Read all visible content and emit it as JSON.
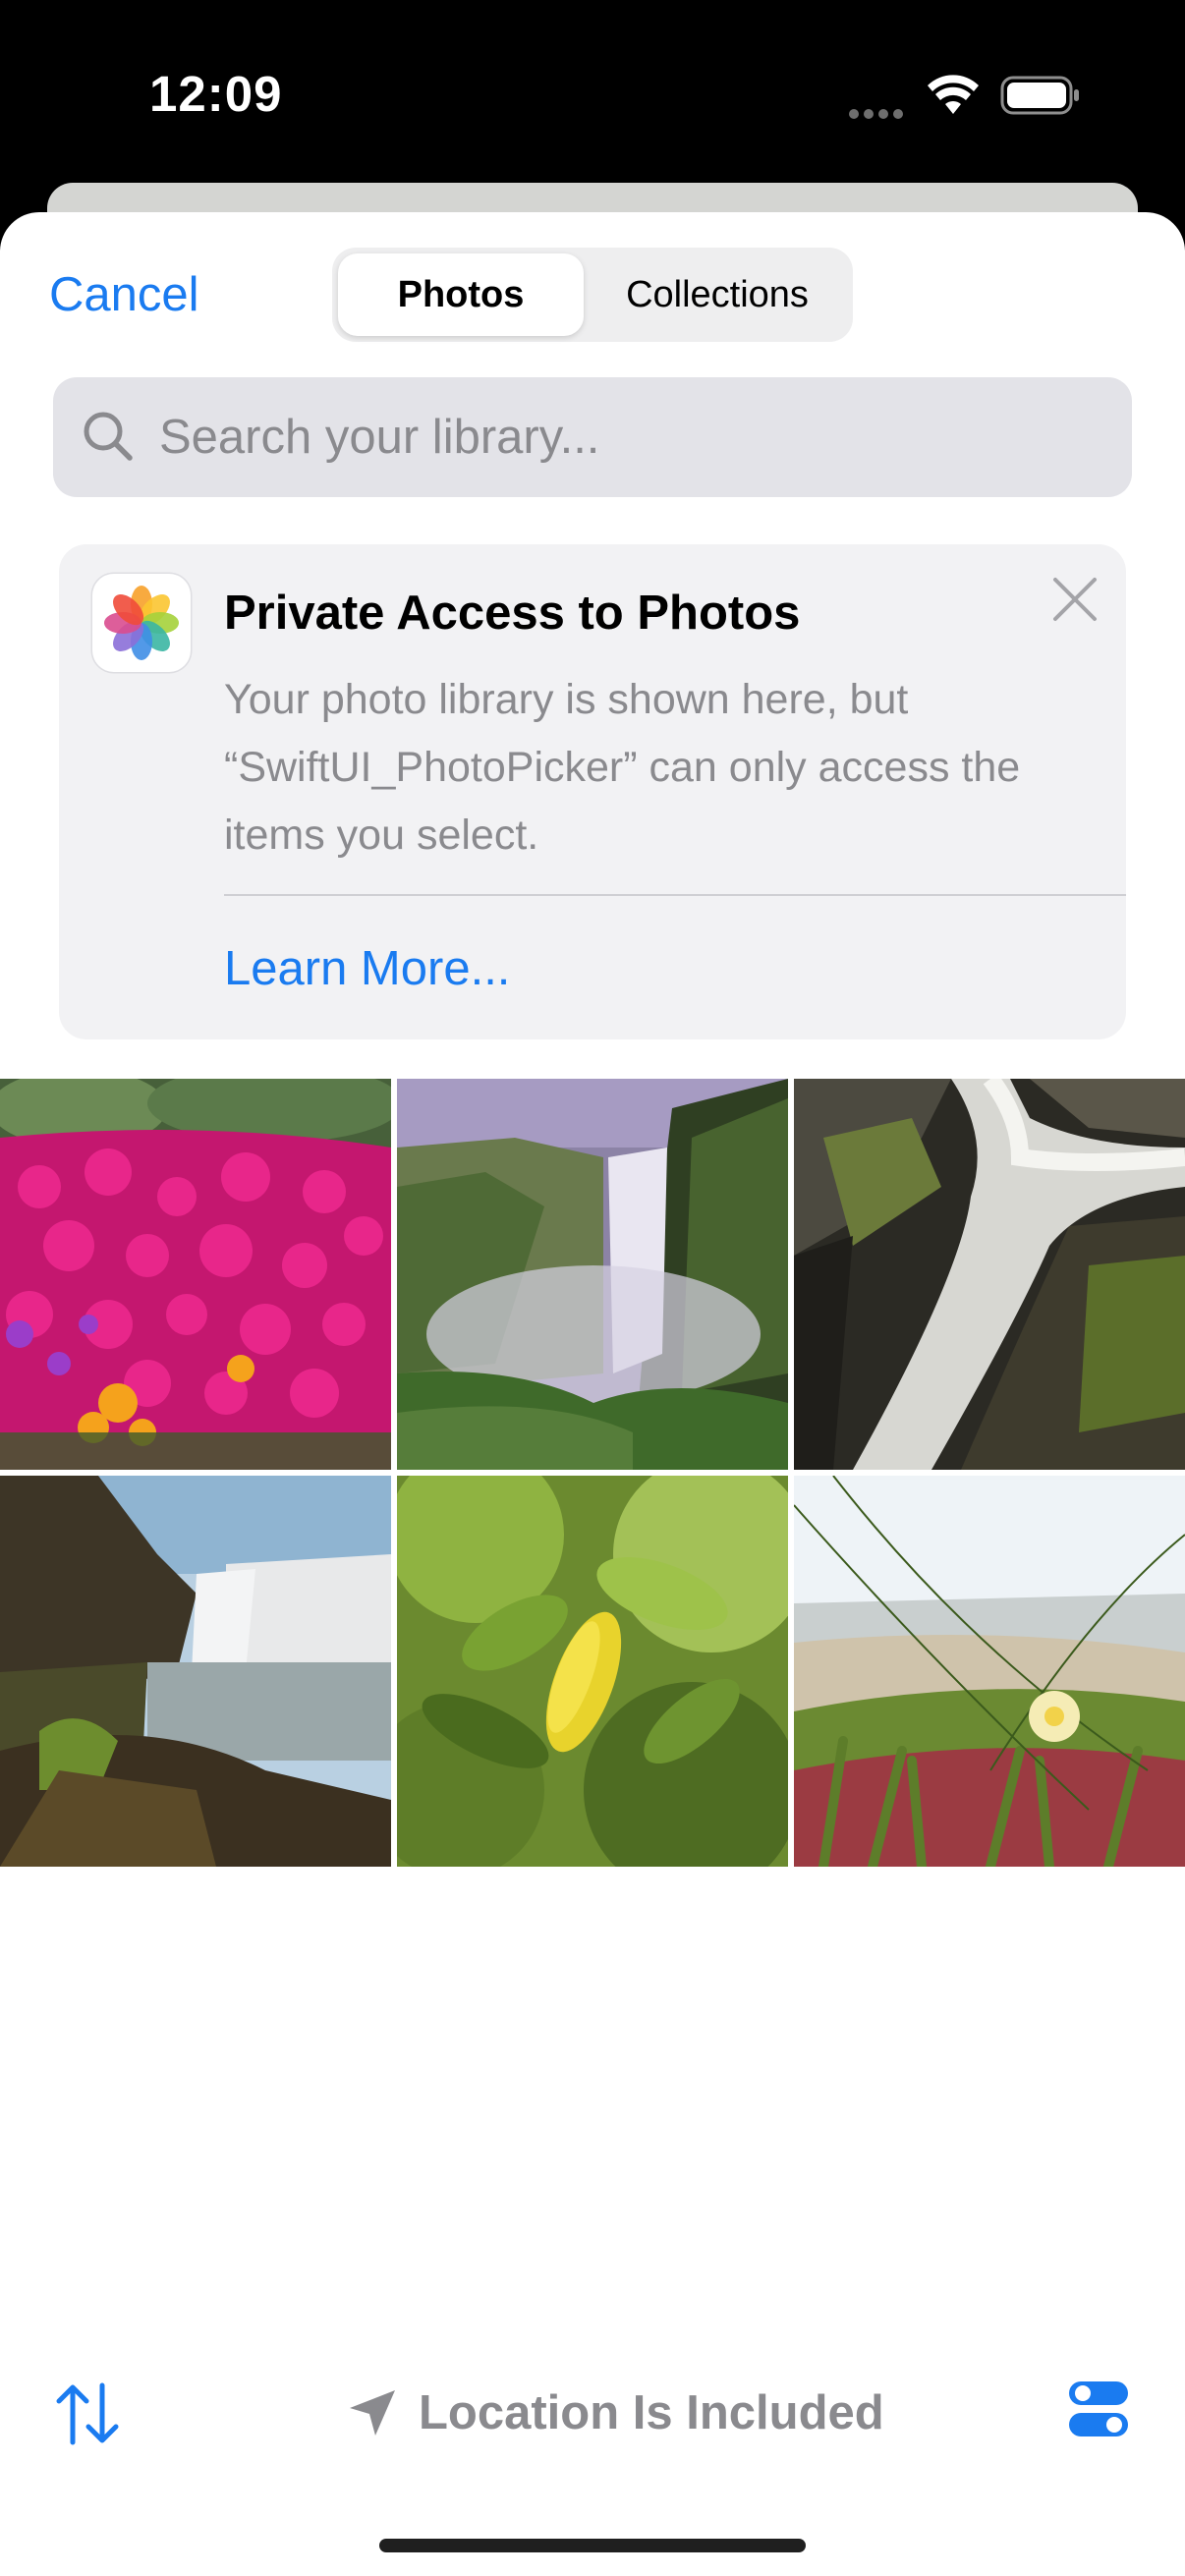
{
  "status_bar": {
    "time": "12:09"
  },
  "header": {
    "cancel_label": "Cancel",
    "tabs": [
      {
        "label": "Photos",
        "selected": true
      },
      {
        "label": "Collections",
        "selected": false
      }
    ]
  },
  "search": {
    "placeholder": "Search your library..."
  },
  "banner": {
    "title": "Private Access to Photos",
    "body": "Your photo library is shown here, but “SwiftUI_PhotoPicker” can only access the items you select.",
    "link_label": "Learn More..."
  },
  "photos": [
    {
      "subject": "pink-flower-field"
    },
    {
      "subject": "waterfall-mist"
    },
    {
      "subject": "waterfall-rocks"
    },
    {
      "subject": "waterfall-cliff"
    },
    {
      "subject": "lemon-leaves"
    },
    {
      "subject": "beach-ice-plant-flower"
    }
  ],
  "toolbar": {
    "sort_icon": "sort-arrows-icon",
    "location_label": "Location Is Included",
    "options_icon": "toggles-icon"
  },
  "colors": {
    "accent": "#1a7bf0",
    "secondary_text": "#8a8a8e"
  }
}
